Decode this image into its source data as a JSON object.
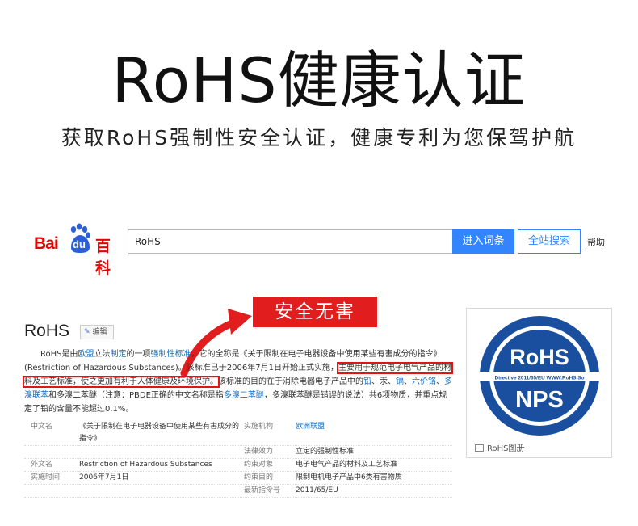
{
  "hero": {
    "title": "RoHS健康认证",
    "subtitle": "获取RoHS强制性安全认证，健康专利为您保驾护航"
  },
  "baike": {
    "logo": {
      "bai": "Bai",
      "du": "du",
      "baike": "百科"
    },
    "search": {
      "value": "RoHS"
    },
    "enter_button": "进入词条",
    "site_search_button": "全站搜索",
    "help_link": "帮助"
  },
  "badge": "安全无害",
  "article": {
    "title": "RoHS",
    "edit_label": "编辑",
    "paragraph": {
      "s1": "RoHS是由",
      "l1": "欧盟",
      "s2": "立法",
      "l2": "制定",
      "s3": "的一项",
      "l3": "强制性标准",
      "s4": "，它的全称是《关于限制在电子电器设备中使用某些有害成分的指令》(Restriction of Hazardous Substances)。该标准已于2006年7月1日开始正式实施，",
      "highlight": "主要用于规范电子电气产品的材料及工艺标准，使之更加有利于人体健康及环境保护。",
      "s5": "该标准的目的在于消除电器电子产品中的",
      "l4": "铅",
      "s6": "、汞、",
      "l5": "镉",
      "s7": "、",
      "l6": "六价铬",
      "s8": "、",
      "l7": "多溴联苯",
      "s9": "和多溴二苯醚（注意：PBDE正确的中文名称是指",
      "l8": "多溴二苯醚",
      "s10": "，多溴联苯醚是错误的说法）共6项物质，并重点规定了铅的含量不能超过0.1%。"
    },
    "info": [
      {
        "k1": "中文名",
        "v1": "《关于限制在电子电器设备中使用某些有害成分的指令》",
        "k2": "实施机构",
        "v2": "欧洲联盟",
        "v2_link": true
      },
      {
        "k1": "",
        "v1": "",
        "k2": "法律效力",
        "v2": "立定的强制性标准",
        "v2_link": false
      },
      {
        "k1": "外文名",
        "v1": "Restriction of Hazardous Substances",
        "k2": "约束对象",
        "v2": "电子电气产品的材料及工艺标准",
        "v2_link": false
      },
      {
        "k1": "实施时间",
        "v1": "2006年7月1日",
        "k2": "约束目的",
        "v2": "限制电机电子产品中6类有害物质",
        "v2_link": false
      },
      {
        "k1": "",
        "v1": "",
        "k2": "最新指令号",
        "v2": "2011/65/EU",
        "v2_link": false
      }
    ]
  },
  "card": {
    "logo_top": "RoHS",
    "logo_band": "Directive 2011/65/EU  WWW.RoHS.So",
    "logo_bottom": "NPS",
    "caption": "RoHS图册"
  },
  "colors": {
    "baidu_red": "#e10601",
    "baidu_blue": "#3385ff",
    "badge_red": "#e21d1d",
    "link_blue": "#136ec2",
    "seal_blue": "#1a4fa0"
  }
}
